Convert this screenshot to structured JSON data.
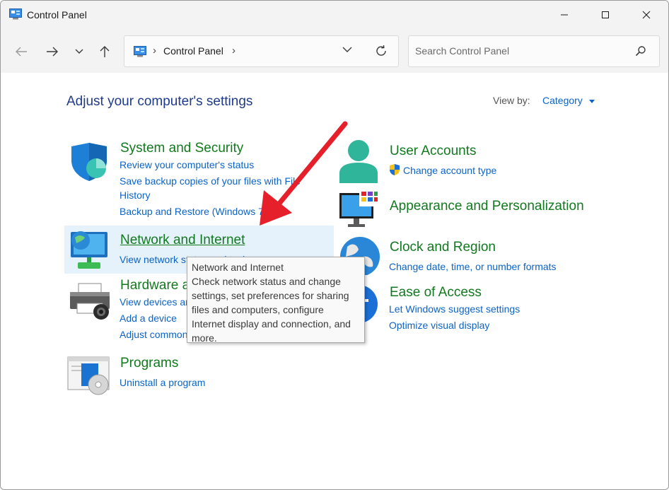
{
  "window": {
    "title": "Control Panel"
  },
  "address": {
    "path": "Control Panel"
  },
  "search": {
    "placeholder": "Search Control Panel"
  },
  "main": {
    "heading": "Adjust your computer's settings",
    "view_by_label": "View by:",
    "view_by_value": "Category"
  },
  "categories": {
    "system": {
      "title": "System and Security",
      "links": [
        "Review your computer's status",
        "Save backup copies of your files with File",
        "History",
        "Backup and Restore (Windows 7)"
      ]
    },
    "network": {
      "title": "Network and Internet",
      "links": [
        "View network status and tasks"
      ]
    },
    "hardware": {
      "title": "Hardware and Sound",
      "links": [
        "View devices and printers",
        "Add a device",
        "Adjust common mobility settings"
      ]
    },
    "programs": {
      "title": "Programs",
      "links": [
        "Uninstall a program"
      ]
    },
    "users": {
      "title": "User Accounts",
      "links": [
        "Change account type"
      ]
    },
    "appearance": {
      "title": "Appearance and Personalization"
    },
    "clock": {
      "title": "Clock and Region",
      "links": [
        "Change date, time, or number formats"
      ]
    },
    "ease": {
      "title": "Ease of Access",
      "links": [
        "Let Windows suggest settings",
        "Optimize visual display"
      ]
    }
  },
  "tooltip": {
    "title": "Network and Internet",
    "lines": [
      "Check network status and change",
      "settings, set preferences for sharing",
      "files and computers, configure",
      "Internet display and connection, and",
      "more."
    ]
  },
  "colors": {
    "category_title": "#127a1e",
    "link": "#0b63c9",
    "heading": "#1e3a8a",
    "annotation_arrow": "#e5202a"
  },
  "icons": [
    "control-panel-icon",
    "minimize-icon",
    "maximize-icon",
    "close-icon",
    "back-arrow-icon",
    "forward-arrow-icon",
    "recent-chevron-icon",
    "up-arrow-icon",
    "refresh-icon",
    "search-icon",
    "shield-icon",
    "network-globe-icon",
    "printer-icon",
    "programs-icon",
    "user-icon",
    "uac-shield-icon",
    "monitor-icon",
    "clock-globe-icon",
    "ease-of-access-icon"
  ]
}
